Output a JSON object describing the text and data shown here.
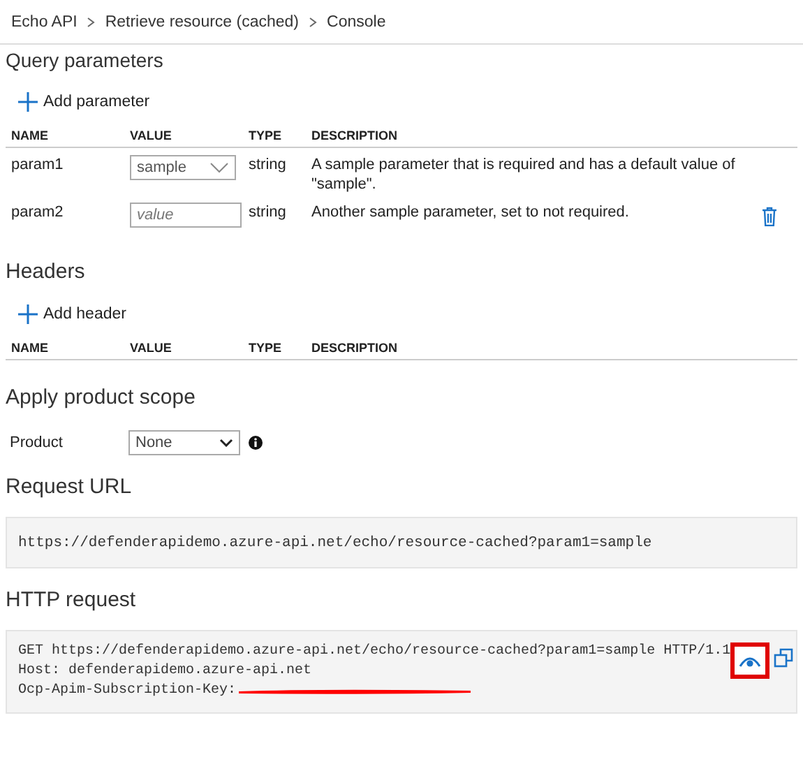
{
  "breadcrumb": [
    "Echo API",
    "Retrieve resource (cached)",
    "Console"
  ],
  "query_parameters": {
    "title": "Query parameters",
    "add_label": "Add parameter",
    "columns": [
      "NAME",
      "VALUE",
      "TYPE",
      "DESCRIPTION"
    ],
    "rows": [
      {
        "name": "param1",
        "kind": "select",
        "value": "sample",
        "type": "string",
        "description": "A sample parameter that is required and has a default value of \"sample\".",
        "deletable": false
      },
      {
        "name": "param2",
        "kind": "input",
        "placeholder": "value",
        "type": "string",
        "description": "Another sample parameter, set to not required.",
        "deletable": true
      }
    ]
  },
  "headers": {
    "title": "Headers",
    "add_label": "Add header",
    "columns": [
      "NAME",
      "VALUE",
      "TYPE",
      "DESCRIPTION"
    ]
  },
  "product_scope": {
    "title": "Apply product scope",
    "label": "Product",
    "value": "None"
  },
  "request_url": {
    "title": "Request URL",
    "url": "https://defenderapidemo.azure-api.net/echo/resource-cached?param1=sample"
  },
  "http_request": {
    "title": "HTTP request",
    "lines": [
      "GET https://defenderapidemo.azure-api.net/echo/resource-cached?param1=sample HTTP/1.1",
      "Host: defenderapidemo.azure-api.net",
      "Ocp-Apim-Subscription-Key:"
    ],
    "key_redacted": true,
    "reveal_highlighted": true
  }
}
